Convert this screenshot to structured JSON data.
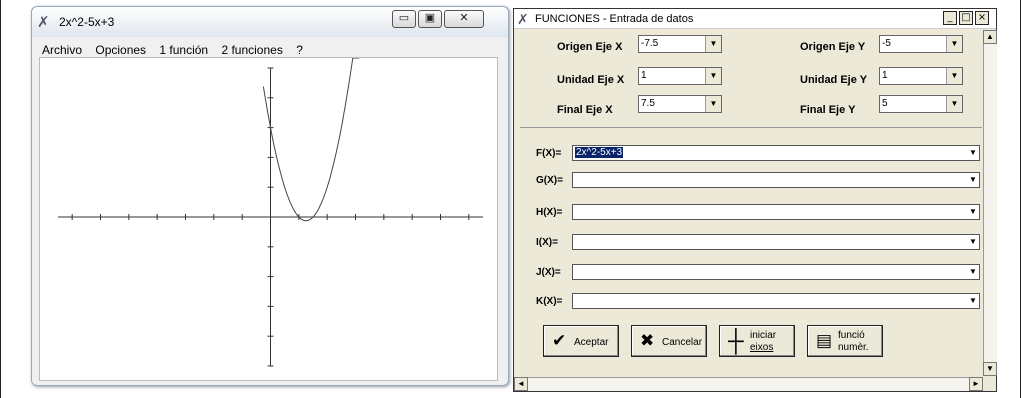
{
  "graph_window": {
    "title": "2x^2-5x+3",
    "menu": [
      "Archivo",
      "Opciones",
      "1 función",
      "2 funciones",
      "?"
    ]
  },
  "chart_data": {
    "type": "line",
    "title": "",
    "function": "2x^2-5x+3",
    "xlim": [
      -7.5,
      7.5
    ],
    "ylim": [
      -5,
      5
    ],
    "x_tick_step": 1,
    "y_tick_step": 1,
    "grid": false,
    "series": [
      {
        "x": [
          -0.25,
          0,
          0.25,
          0.5,
          0.75,
          1,
          1.25,
          1.5,
          1.75,
          2,
          2.25,
          2.5,
          2.75,
          3,
          3.25
        ],
        "values": [
          4.375,
          3,
          1.875,
          1,
          0.375,
          0,
          -0.125,
          0,
          0.375,
          1,
          1.875,
          3,
          4.375,
          6,
          7.875
        ]
      }
    ],
    "line_color": "#444444"
  },
  "func_window": {
    "title": "FUNCIONES - Entrada de datos",
    "controls": {
      "minimize": "_",
      "maximize": "□",
      "close": "×"
    },
    "axes": {
      "origin_x": {
        "label": "Origen Eje X",
        "value": "-7.5"
      },
      "origin_y": {
        "label": "Origen Eje Y",
        "value": "-5"
      },
      "unit_x": {
        "label": "Unidad Eje X",
        "value": "1"
      },
      "unit_y": {
        "label": "Unidad Eje Y",
        "value": "1"
      },
      "final_x": {
        "label": "Final Eje X",
        "value": "7.5"
      },
      "final_y": {
        "label": "Final Eje Y",
        "value": "5"
      }
    },
    "functions": [
      {
        "label": "F(X)=",
        "value": "2x^2-5x+3"
      },
      {
        "label": "G(X)=",
        "value": ""
      },
      {
        "label": "H(X)=",
        "value": ""
      },
      {
        "label": "I(X)=",
        "value": ""
      },
      {
        "label": "J(X)=",
        "value": ""
      },
      {
        "label": "K(X)=",
        "value": ""
      }
    ],
    "buttons": {
      "accept": "Aceptar",
      "cancel": "Cancelar",
      "init_axes_1": "iniciar",
      "init_axes_2": "eixos",
      "numeric_1": "funció",
      "numeric_2": "numèr."
    },
    "dropdown_arrow": "▼",
    "scroll_up": "▲",
    "scroll_down": "▼",
    "scroll_left": "◄",
    "scroll_right": "►"
  }
}
